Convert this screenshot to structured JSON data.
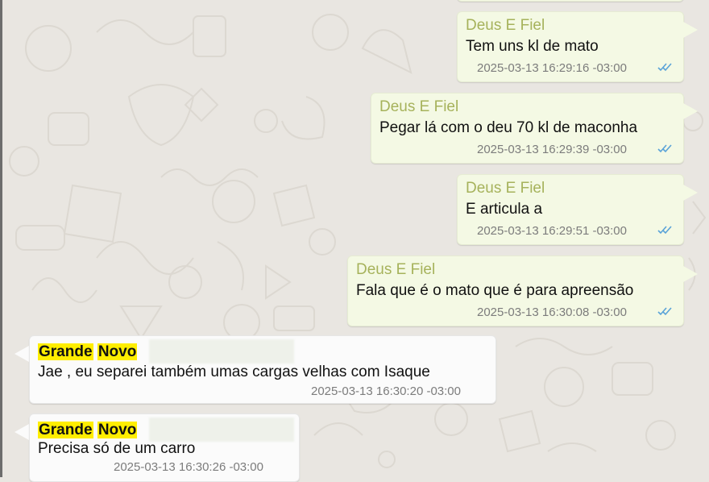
{
  "outgoing": [
    {
      "sender": "Deus E Fiel",
      "text": "Tem uns kl de mato",
      "timestamp": "2025-03-13 16:29:16 -03:00"
    },
    {
      "sender": "Deus E Fiel",
      "text": "Pegar lá com o deu 70 kl de maconha",
      "timestamp": "2025-03-13 16:29:39 -03:00"
    },
    {
      "sender": "Deus E Fiel",
      "text": "E articula a",
      "timestamp": "2025-03-13 16:29:51 -03:00"
    },
    {
      "sender": "Deus E Fiel",
      "text": "Fala que é o mato que é para apreensão",
      "timestamp": "2025-03-13 16:30:08 -03:00"
    }
  ],
  "incoming": [
    {
      "sender_first": "Grande",
      "sender_second": "Novo",
      "text": "Jae , eu separei também umas cargas velhas com Isaque",
      "timestamp": "2025-03-13 16:30:20 -03:00"
    },
    {
      "sender_first": "Grande",
      "sender_second": "Novo",
      "text": "Precisa só de um carro",
      "timestamp": "2025-03-13 16:30:26 -03:00"
    }
  ],
  "colors": {
    "outgoing_bubble": "#f4f9e4",
    "incoming_bubble": "#fbfbfb",
    "sender_name": "#a6b25b",
    "highlight": "#ffee00",
    "read_ticks": "#5aa3d8",
    "background": "#e9e6e1"
  },
  "icons": {
    "read_receipt": "double-check-icon"
  }
}
